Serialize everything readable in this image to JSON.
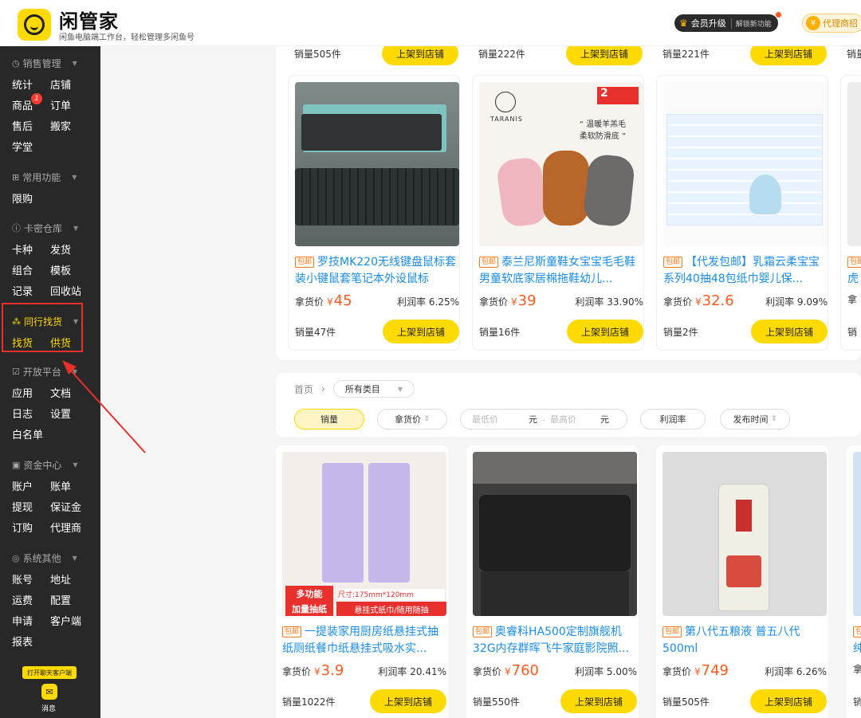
{
  "header": {
    "brand": "闲管家",
    "subtitle": "闲鱼电脑端工作台，轻松管理多闲鱼号",
    "vip_label": "会员升级",
    "vip_sub": "解锁新功能",
    "agent_label": "代理商招"
  },
  "sidebar": {
    "groups": [
      {
        "title": "销售管理",
        "items": [
          "统计",
          "店铺",
          "商品",
          "订单",
          "售后",
          "搬家",
          "学堂"
        ]
      },
      {
        "title": "常用功能",
        "items": [
          "限购"
        ]
      },
      {
        "title": "卡密仓库",
        "items": [
          "卡种",
          "发货",
          "组合",
          "模板",
          "记录",
          "回收站"
        ]
      },
      {
        "title": "同行找货",
        "items": [
          "找货",
          "供货"
        ]
      },
      {
        "title": "开放平台",
        "items": [
          "应用",
          "文档",
          "日志",
          "设置",
          "白名单"
        ]
      },
      {
        "title": "资金中心",
        "items": [
          "账户",
          "账单",
          "提现",
          "保证金",
          "订购",
          "代理商"
        ]
      },
      {
        "title": "系统其他",
        "items": [
          "账号",
          "地址",
          "运费",
          "配置",
          "申请",
          "客户端",
          "报表"
        ]
      }
    ],
    "product_badge": "1",
    "chat_btn": "打开聊天客户端",
    "msg_label": "消息"
  },
  "top_strip": [
    {
      "sold": "销量505件",
      "btn": "上架到店铺"
    },
    {
      "sold": "销量222件",
      "btn": "上架到店铺"
    },
    {
      "sold": "销量221件",
      "btn": "上架到店铺"
    },
    {
      "sold": "销量"
    }
  ],
  "row1": [
    {
      "tag": "包邮",
      "title": "罗技MK220无线键盘鼠标套装小键鼠套笔记本外设鼠标",
      "price_label": "拿货价",
      "price_sym": "¥",
      "price": "45",
      "margin": "利润率 6.25%",
      "sold": "销量47件",
      "btn": "上架到店铺"
    },
    {
      "tag": "包邮",
      "title": "泰兰尼斯童鞋女宝宝毛毛鞋男童软底家居棉拖鞋幼儿...",
      "price_label": "拿货价",
      "price_sym": "¥",
      "price": "39",
      "margin": "利润率 33.90%",
      "sold": "销量16件",
      "btn": "上架到店铺"
    },
    {
      "tag": "包邮",
      "title": "【代发包邮】乳霜云柔宝宝系列40抽48包纸巾婴儿保...",
      "price_label": "拿货价",
      "price_sym": "¥",
      "price": "32.6",
      "margin": "利润率 9.09%",
      "sold": "销量2件",
      "btn": "上架到店铺"
    },
    {
      "tag": "包邮",
      "title": "虎",
      "price_label": "拿",
      "sold": "销"
    }
  ],
  "slipper_art": {
    "brand": "TARANIS",
    "quote": "“ 温暖羊羔毛\n柔软防滑底 ”",
    "corner": "2"
  },
  "filters": {
    "home": "首页",
    "category": "所有类目",
    "sort": [
      "销量",
      "拿货价",
      "利润率",
      "发布时间"
    ],
    "min_price": "最低价",
    "max_price": "最高价",
    "unit": "元",
    "dash": "-"
  },
  "row2": [
    {
      "tag": "包邮",
      "title": "一提装家用厨房纸悬挂式抽纸厕纸餐巾纸悬挂式吸水实...",
      "price_label": "拿货价",
      "price_sym": "¥",
      "price": "3.9",
      "margin": "利润率 20.41%",
      "sold": "销量1022件",
      "btn": "上架到店铺",
      "banner1": "多功能",
      "banner2": "加量抽纸",
      "banner3": "尺寸:175mm*120mm",
      "banner4": "悬挂式纸巾/随用随抽"
    },
    {
      "tag": "包邮",
      "title": "奥睿科HA500定制旗舰机32G内存群晖飞牛家庭影院照...",
      "price_label": "拿货价",
      "price_sym": "¥",
      "price": "760",
      "margin": "利润率 5.00%",
      "sold": "销量550件",
      "btn": "上架到店铺"
    },
    {
      "tag": "包邮",
      "title": "第八代五粮液 普五八代 500ml",
      "price_label": "拿货价",
      "price_sym": "¥",
      "price": "749",
      "margin": "利润率 6.26%",
      "sold": "销量505件",
      "btn": "上架到店铺"
    },
    {
      "tag": "包",
      "title": "纯",
      "price_label": "拿",
      "sold": "销"
    }
  ],
  "colors": {
    "accent": "#ffda00",
    "price": "#ff5a1f",
    "link": "#1a8ce8",
    "sidebar": "#282828",
    "highlight": "#e8302d"
  }
}
